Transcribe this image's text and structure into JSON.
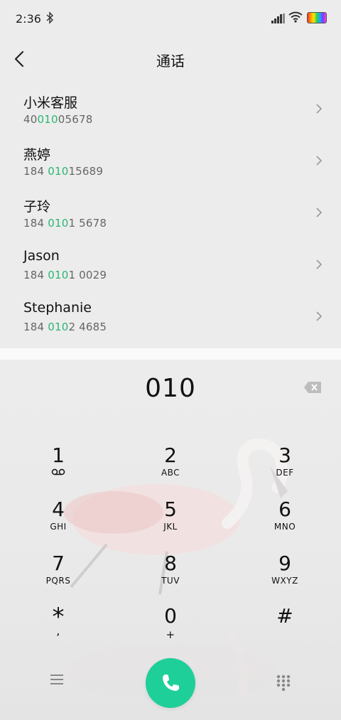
{
  "status_bar": {
    "time": "2:36",
    "icons": [
      "bluetooth-icon",
      "signal-icon",
      "wifi-icon",
      "battery-icon"
    ]
  },
  "header": {
    "title": "通话",
    "back_icon": "chevron-left-icon"
  },
  "contacts": [
    {
      "name": "小米客服",
      "number_pre": "40",
      "number_match": "010",
      "number_post": "05678"
    },
    {
      "name": "燕婷",
      "number_pre": "184 ",
      "number_match": "010",
      "number_post": "15689"
    },
    {
      "name": "子玲",
      "number_pre": "184 ",
      "number_match": "010",
      "number_post": "1 5678"
    },
    {
      "name": "Jason",
      "number_pre": "184 ",
      "number_match": "010",
      "number_post": "1 0029"
    },
    {
      "name": "Stephanie",
      "number_pre": "184 ",
      "number_match": "010",
      "number_post": "2 4685"
    }
  ],
  "dialer": {
    "entered_number": "010",
    "keys": [
      {
        "digit": "1",
        "letters": "voicemail-icon"
      },
      {
        "digit": "2",
        "letters": "ABC"
      },
      {
        "digit": "3",
        "letters": "DEF"
      },
      {
        "digit": "4",
        "letters": "GHI"
      },
      {
        "digit": "5",
        "letters": "JKL"
      },
      {
        "digit": "6",
        "letters": "MNO"
      },
      {
        "digit": "7",
        "letters": "PQRS"
      },
      {
        "digit": "8",
        "letters": "TUV"
      },
      {
        "digit": "9",
        "letters": "WXYZ"
      },
      {
        "digit": "*",
        "letters": ","
      },
      {
        "digit": "0",
        "letters": "+"
      },
      {
        "digit": "#",
        "letters": ""
      }
    ]
  },
  "colors": {
    "match_highlight": "#2bb673",
    "call_button": "#1fcf9a",
    "background": "#ececec"
  }
}
